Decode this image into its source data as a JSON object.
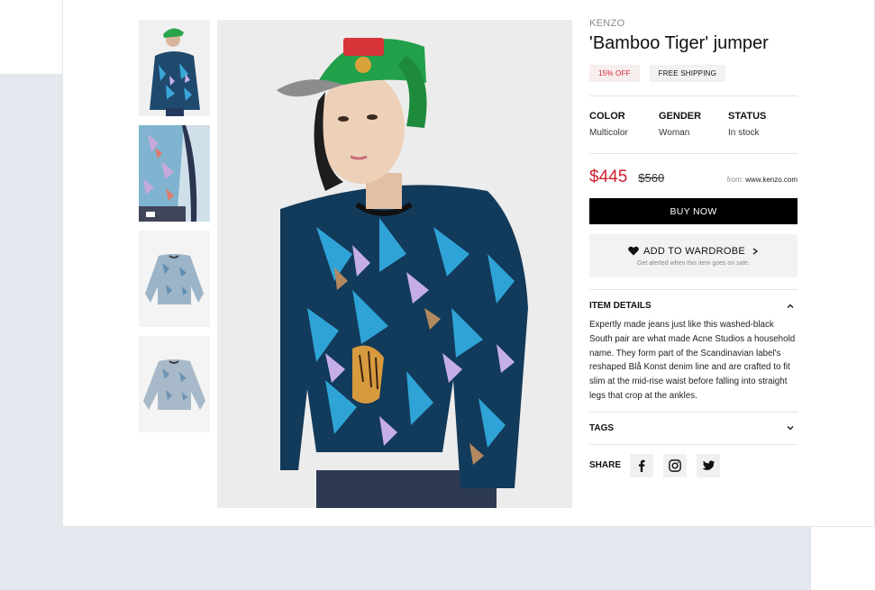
{
  "product": {
    "brand": "KENZO",
    "title": "'Bamboo Tiger' jumper",
    "badges": {
      "discount": "15% OFF",
      "shipping": "FREE SHIPPING"
    },
    "attributes": [
      {
        "key": "COLOR",
        "value": "Multicolor"
      },
      {
        "key": "GENDER",
        "value": "Woman"
      },
      {
        "key": "STATUS",
        "value": "In stock"
      }
    ],
    "price": "$445",
    "old_price": "$560",
    "from_label": "from:",
    "from_site": "www.kenzo.com",
    "buy_label": "BUY NOW",
    "wardrobe": {
      "label": "ADD TO WARDROBE",
      "sub": "Get alerted when this item goes on sale."
    },
    "details_heading": "ITEM DETAILS",
    "description": "Expertly made jeans just like this washed-black South pair are what made Acne Studios a household name. They form part of the Scandinavian label's reshaped Blå Konst denim line and are crafted to fit slim at the mid-rise waist before falling into straight legs that crop at the ankles.",
    "tags_heading": "TAGS",
    "share_label": "SHARE"
  },
  "icons": {
    "heart": "heart-icon",
    "chevron_right": "chevron-right-icon",
    "chevron_up": "chevron-up-icon",
    "chevron_down": "chevron-down-icon",
    "facebook": "facebook-icon",
    "instagram": "instagram-icon",
    "twitter": "twitter-icon"
  },
  "colors": {
    "accent_red": "#d01f2f",
    "button_black": "#000000",
    "page_bg": "#e3e7ee"
  }
}
